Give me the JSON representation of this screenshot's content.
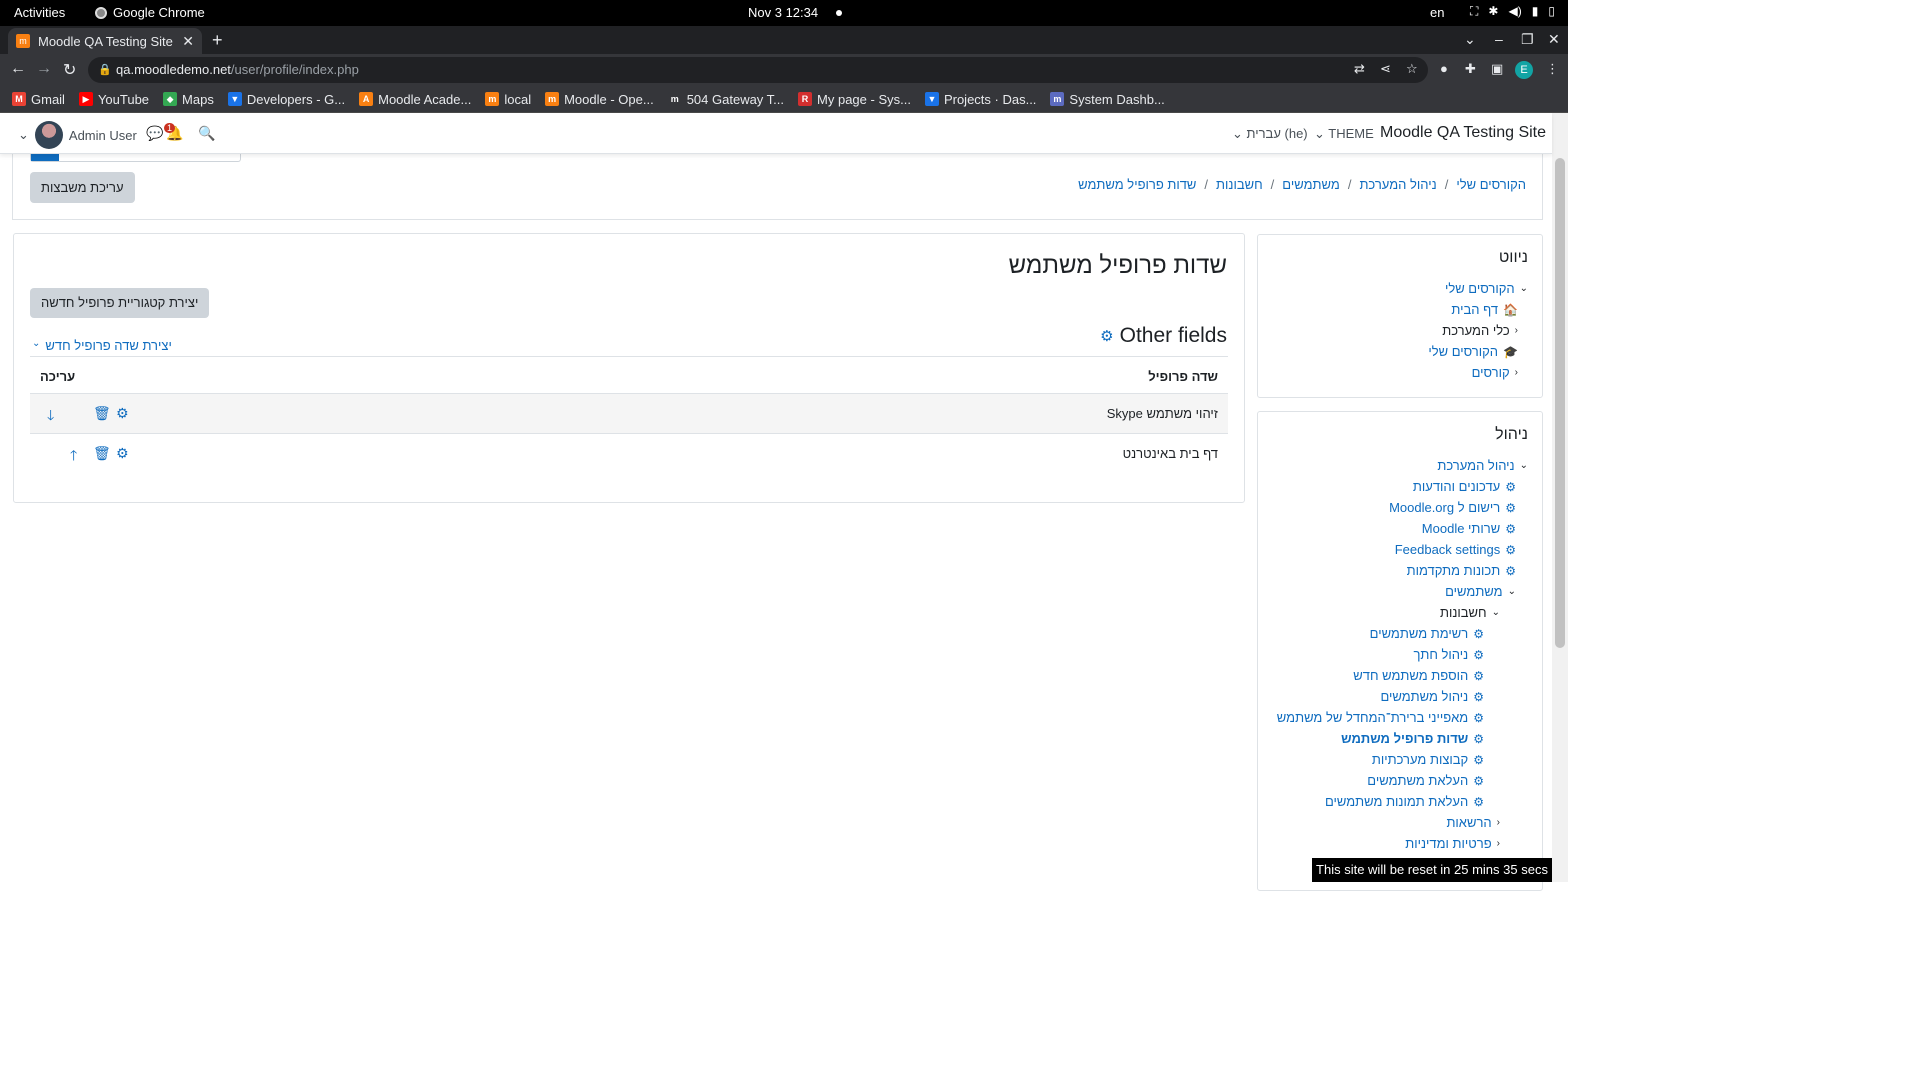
{
  "os": {
    "activities": "Activities",
    "app": "Google Chrome",
    "clock": "Nov 3  12:34",
    "lang": "en"
  },
  "browser": {
    "tab_title": "Moodle QA Testing Site: W",
    "url_host": "qa.moodledemo.net",
    "url_path": "/user/profile/index.php",
    "avatar_letter": "E",
    "bookmarks": [
      {
        "label": "Gmail",
        "color": "#ea4335",
        "glyph": "M"
      },
      {
        "label": "YouTube",
        "color": "#ff0000",
        "glyph": "▶"
      },
      {
        "label": "Maps",
        "color": "#34a853",
        "glyph": "◆"
      },
      {
        "label": "Developers - G...",
        "color": "#1a73e8",
        "glyph": "▼"
      },
      {
        "label": "Moodle Acade...",
        "color": "#f98012",
        "glyph": "A"
      },
      {
        "label": "local",
        "color": "#f98012",
        "glyph": "m"
      },
      {
        "label": "Moodle - Ope...",
        "color": "#f98012",
        "glyph": "m"
      },
      {
        "label": "504 Gateway T...",
        "color": "#35363a",
        "glyph": "m"
      },
      {
        "label": "My page - Sys...",
        "color": "#d32f2f",
        "glyph": "R"
      },
      {
        "label": "Projects · Das...",
        "color": "#1a73e8",
        "glyph": "▼"
      },
      {
        "label": "System Dashb...",
        "color": "#5c6bc0",
        "glyph": "m"
      }
    ]
  },
  "navbar": {
    "user": "Admin User",
    "notif_count": "1",
    "language": "עברית (he)",
    "theme": "THEME",
    "site_name": "Moodle QA Testing Site"
  },
  "header": {
    "edit_blocks": "עריכת משבצות",
    "breadcrumb": [
      "הקורסים שלי",
      "ניהול המערכת",
      "משתמשים",
      "חשבונות",
      "שדות פרופיל משתמש"
    ]
  },
  "main": {
    "title": "שדות פרופיל משתמש",
    "new_category_button": "יצירת קטגוריית פרופיל חדשה",
    "section_title": "Other fields",
    "create_field": "יצירת שדה פרופיל חדש",
    "columns": {
      "field": "שדה פרופיל",
      "edit": "עריכה"
    },
    "rows": [
      {
        "name": "זיהוי משתמש Skype",
        "move": "down"
      },
      {
        "name": "דף בית באינטרנט",
        "move": "up"
      }
    ]
  },
  "navigation_block": {
    "title": "ניווט",
    "items": [
      {
        "label": "הקורסים שלי",
        "icon": "chevron-down"
      },
      {
        "label": "דף הבית",
        "icon": "home"
      },
      {
        "label": "כלי המערכת",
        "icon": "chevron-left"
      },
      {
        "label": "הקורסים שלי",
        "icon": "graduation-cap"
      },
      {
        "label": "קורסים",
        "icon": "chevron-left"
      }
    ]
  },
  "admin_block": {
    "title": "ניהול",
    "items": [
      {
        "label": "ניהול המערכת",
        "icon": "chevron-down"
      },
      {
        "label": "עדכונים והודעות",
        "icon": "gear"
      },
      {
        "label": "רישום ל Moodle.org",
        "icon": "gear"
      },
      {
        "label": "שרותי Moodle",
        "icon": "gear"
      },
      {
        "label": "Feedback settings",
        "icon": "gear"
      },
      {
        "label": "תכונות מתקדמות",
        "icon": "gear"
      },
      {
        "label": "משתמשים",
        "icon": "chevron-down"
      },
      {
        "label": "חשבונות",
        "icon": "chevron-down"
      },
      {
        "label": "רשימת משתמשים",
        "icon": "gear"
      },
      {
        "label": "ניהול חתך",
        "icon": "gear"
      },
      {
        "label": "הוספת משתמש חדש",
        "icon": "gear"
      },
      {
        "label": "ניהול משתמשים",
        "icon": "gear"
      },
      {
        "label": "מאפייני ברירת־המחדל של משתמש",
        "icon": "gear"
      },
      {
        "label": "שדות פרופיל משתמש",
        "icon": "gear"
      },
      {
        "label": "קבוצות מערכתיות",
        "icon": "gear"
      },
      {
        "label": "העלאת משתמשים",
        "icon": "gear"
      },
      {
        "label": "העלאת תמונות משתמשים",
        "icon": "gear"
      },
      {
        "label": "הרשאות",
        "icon": "chevron-left"
      },
      {
        "label": "פרטיות ומדיניות",
        "icon": "chevron-left"
      }
    ]
  },
  "reset_banner": "This site will be reset in 25 mins 35 secs"
}
